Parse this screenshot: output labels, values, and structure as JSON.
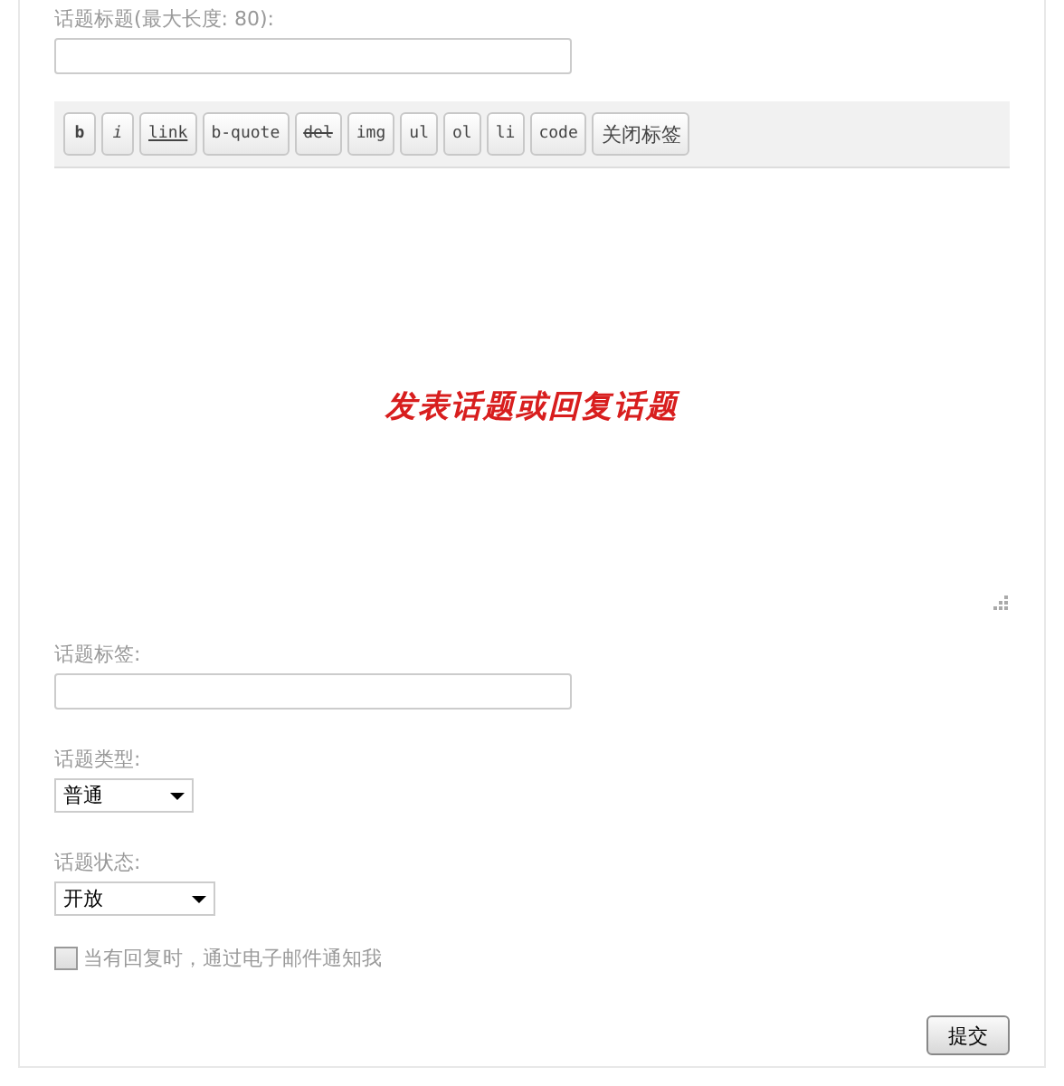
{
  "title_field": {
    "label": "话题标题(最大长度: 80):"
  },
  "toolbar": [
    {
      "label": "b",
      "kind": "bold"
    },
    {
      "label": "i",
      "kind": "italic"
    },
    {
      "label": "link",
      "kind": "underline"
    },
    {
      "label": "b-quote",
      "kind": "plain"
    },
    {
      "label": "del",
      "kind": "strike"
    },
    {
      "label": "img",
      "kind": "plain"
    },
    {
      "label": "ul",
      "kind": "plain"
    },
    {
      "label": "ol",
      "kind": "plain"
    },
    {
      "label": "li",
      "kind": "plain"
    },
    {
      "label": "code",
      "kind": "plain"
    },
    {
      "label": "关闭标签",
      "kind": "wide"
    }
  ],
  "editor": {
    "caption": "发表话题或回复话题"
  },
  "tags_field": {
    "label": "话题标签:"
  },
  "type_select": {
    "label": "话题类型:",
    "value": "普通"
  },
  "status_select": {
    "label": "话题状态:",
    "value": "开放"
  },
  "notify": {
    "label": "当有回复时，通过电子邮件通知我",
    "checked": false
  },
  "submit": {
    "label": "提交"
  }
}
